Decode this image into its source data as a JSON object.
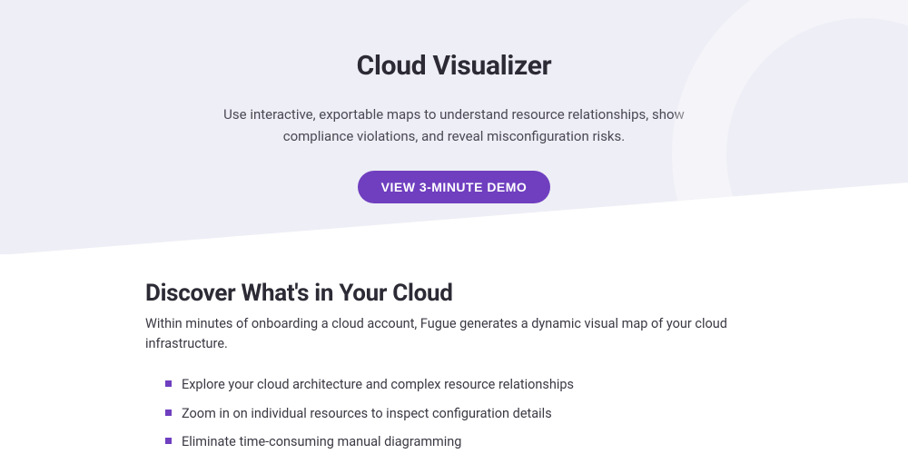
{
  "hero": {
    "title": "Cloud Visualizer",
    "subtitle": "Use interactive, exportable maps to understand resource relationships, show compliance violations, and reveal misconfiguration risks.",
    "cta_label": "VIEW 3-MINUTE DEMO"
  },
  "section": {
    "title": "Discover What's in Your Cloud",
    "subtitle": "Within minutes of onboarding a cloud account, Fugue generates a dynamic visual map of your cloud infrastructure.",
    "bullets": [
      "Explore your cloud architecture and complex resource relationships",
      "Zoom in on individual resources to inspect configuration details",
      "Eliminate time-consuming manual diagramming"
    ]
  },
  "colors": {
    "accent": "#6f3fbf",
    "hero_bg": "#eeeef6",
    "heading": "#2c2b35"
  }
}
